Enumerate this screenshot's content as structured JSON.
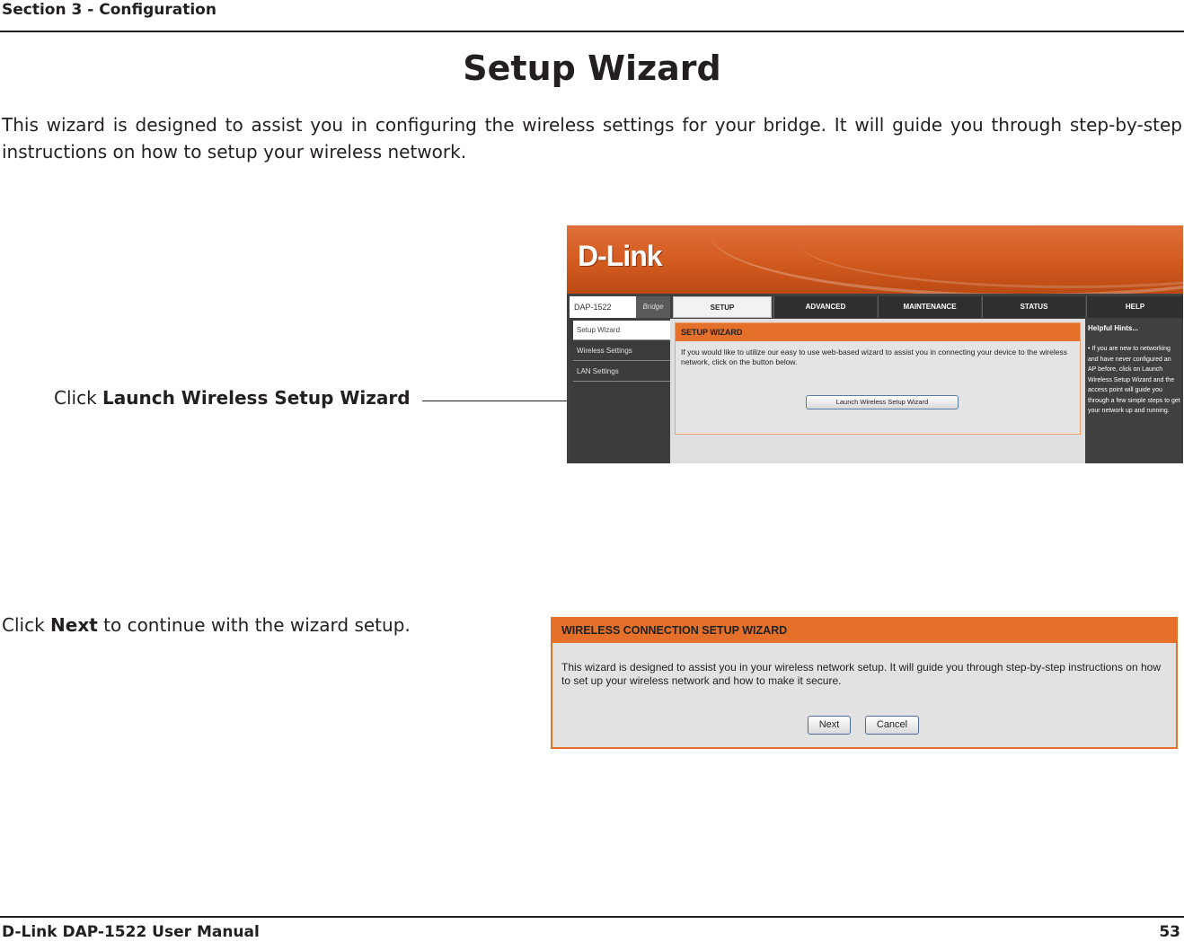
{
  "header": {
    "section": "Section 3 - Configuration"
  },
  "title": "Setup Wizard",
  "intro": "This wizard is designed to assist you in configuring the wireless settings for your bridge. It will guide you through step-by-step instructions on how to setup your wireless network.",
  "callout_launch": {
    "prefix": "Click ",
    "bold": "Launch Wireless Setup Wizard"
  },
  "callout_next": {
    "prefix": "Click ",
    "bold": "Next",
    "suffix": " to continue with the wizard setup."
  },
  "dlink_ui": {
    "logo": "D-Link",
    "model": "DAP-1522",
    "mode": "Bridge",
    "tabs": [
      "SETUP",
      "ADVANCED",
      "MAINTENANCE",
      "STATUS",
      "HELP"
    ],
    "sidebar": [
      "Setup Wizard",
      "Wireless Settings",
      "LAN Settings"
    ],
    "panel_title": "SETUP WIZARD",
    "panel_text": "If you would like to utilize our easy to use web-based wizard to assist you in connecting your device to the wireless network, click on the button below.",
    "launch_button": "Launch Wireless Setup Wizard",
    "hints_title": "Helpful Hints...",
    "hints_text": "• If you are new to networking and have never configured an AP before, click on Launch Wireless Setup Wizard and the access point will guide you through a few simple steps to get your network up and running."
  },
  "wizard_ui": {
    "title": "WIRELESS CONNECTION SETUP WIZARD",
    "text": "This wizard is designed to assist you in your wireless network setup. It will guide you through step-by-step instructions on how to set up your wireless network and how to make it secure.",
    "next_button": "Next",
    "cancel_button": "Cancel"
  },
  "footer": {
    "manual": "D-Link DAP-1522 User Manual",
    "page": "53"
  },
  "colors": {
    "accent_orange": "#e4702a",
    "text": "#231f20",
    "dlink_dark": "#404040"
  }
}
